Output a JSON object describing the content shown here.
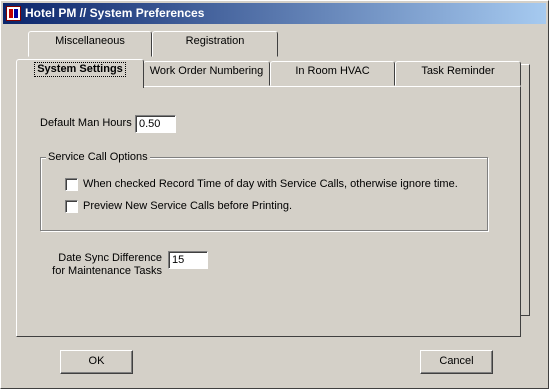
{
  "window": {
    "title": "Hotel PM // System Preferences"
  },
  "tabs": {
    "back_row": [
      "Miscellaneous",
      "Registration"
    ],
    "front_row": [
      "System Settings",
      "Work Order Numbering",
      "In Room HVAC",
      "Task Reminder"
    ],
    "active": "System Settings"
  },
  "settings": {
    "man_hours_label": "Default Man Hours",
    "man_hours_value": "0.50",
    "service_call_group": "Service Call Options",
    "record_time_label": "When checked Record Time of day with Service Calls, otherwise ignore time.",
    "record_time_checked": false,
    "preview_label": "Preview New Service Calls before Printing.",
    "preview_checked": false,
    "sync_label_line1": "Date Sync Difference",
    "sync_label_line2": "for Maintenance Tasks",
    "sync_value": "15"
  },
  "buttons": {
    "ok": "OK",
    "cancel": "Cancel"
  }
}
